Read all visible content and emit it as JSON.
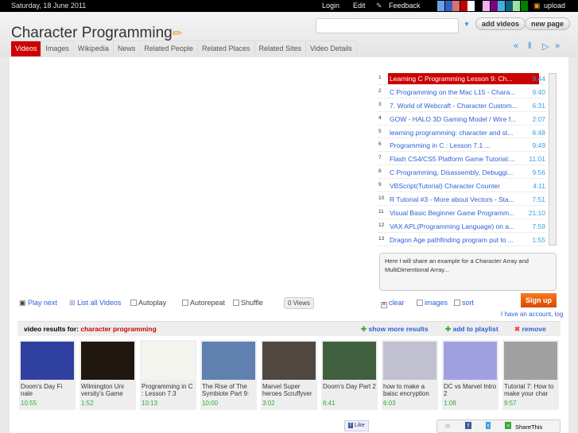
{
  "topbar": {
    "date": "Saturday, 18 June 2011",
    "login": "Login",
    "edit": "Edit",
    "feedback": "Feedback",
    "upload": "upload",
    "swatches": [
      "#6aa0e8",
      "#3060c0",
      "#e07070",
      "#c00000",
      "#ffffff",
      "#000000",
      "#f0b0f0",
      "#800080",
      "#40b0e0",
      "#106080",
      "#a0e0a0",
      "#008000"
    ]
  },
  "header": {
    "title": "Character Programming",
    "search_value": "",
    "add_videos": "add videos",
    "new_page": "new page"
  },
  "tabs": [
    "Videos",
    "Images",
    "Wikipedia",
    "News",
    "Related People",
    "Related Places",
    "Related Sites",
    "Video Details"
  ],
  "media_controls": [
    "rewind",
    "pause",
    "play",
    "fast-forward"
  ],
  "playlist": [
    {
      "n": "1",
      "title": "Learning C Programming Lesson 9: Ch...",
      "dur": "9:44"
    },
    {
      "n": "2",
      "title": "C Programming on the Mac L15 - Chara...",
      "dur": "9:40"
    },
    {
      "n": "3",
      "title": "7. World of Webcraft - Character Custom...",
      "dur": "6:31"
    },
    {
      "n": "4",
      "title": "GOW - HALO 3D Gaming Model / Wire f...",
      "dur": "2:07"
    },
    {
      "n": "5",
      "title": "learning programming: character and st...",
      "dur": "6:48"
    },
    {
      "n": "6",
      "title": "Programming in C : Lesson 7.1          ...",
      "dur": "9:49"
    },
    {
      "n": "7",
      "title": "Flash CS4/CS5 Platform Game Tutorial:...",
      "dur": "11:01"
    },
    {
      "n": "8",
      "title": "C Programming, Disassembly, Debuggi...",
      "dur": "9:56"
    },
    {
      "n": "9",
      "title": "VBScript(Tutorial) Character Counter",
      "dur": "4:11"
    },
    {
      "n": "10",
      "title": "R Tutorial #3 - More about Vectors - Sta...",
      "dur": "7:51"
    },
    {
      "n": "11",
      "title": "Visual Basic Beginner Game Programm...",
      "dur": "21:10"
    },
    {
      "n": "12",
      "title": "VAX APL(Programming Language) on a...",
      "dur": "7:59"
    },
    {
      "n": "13",
      "title": "Dragon Age pathfinding program put to ...",
      "dur": "1:55"
    }
  ],
  "description": "Here I will share an example for a Character Array and MultiDimentional Array...",
  "controls": {
    "play_next": "Play next",
    "list_all": "List all Videos",
    "autoplay": "Autoplay",
    "autorepeat": "Autorepeat",
    "shuffle": "Shuffle",
    "views": "0 Views",
    "clear": "clear",
    "images": "images",
    "sort": "sort",
    "signup": "Sign up",
    "account": "I have an account, log"
  },
  "results": {
    "label": "video results for:",
    "query": "character programming",
    "show_more": "show more results",
    "add_playlist": "add to playlist",
    "remove": "remove"
  },
  "thumbs": [
    {
      "title": "Doom's Day Fi nale",
      "dur": "10:55",
      "color": "#3040a0"
    },
    {
      "title": "Wilmington Uni versity's Game",
      "dur": "1:52",
      "color": "#201810"
    },
    {
      "title": "Programming in C : Lesson 7.3",
      "dur": "10:13",
      "color": "#f4f4ee"
    },
    {
      "title": "The Rise of The Symbiote Part 9:",
      "dur": "10:00",
      "color": "#6080b0"
    },
    {
      "title": "Marvel Super heroes Scruffyver",
      "dur": "3:02",
      "color": "#504840"
    },
    {
      "title": "Doom's Day Part 2",
      "dur": "6:41",
      "color": "#406040"
    },
    {
      "title": "how to make a baisc encryption",
      "dur": "6:03",
      "color": "#c0c0d0"
    },
    {
      "title": "DC vs Marvel Intro 2",
      "dur": "1:08",
      "color": "#a0a0e0"
    },
    {
      "title": "Tutorial 7: How to make your char",
      "dur": "9:57",
      "color": "#a0a0a0"
    }
  ],
  "footer": {
    "like": "Like",
    "sharethis": "ShareThis"
  }
}
